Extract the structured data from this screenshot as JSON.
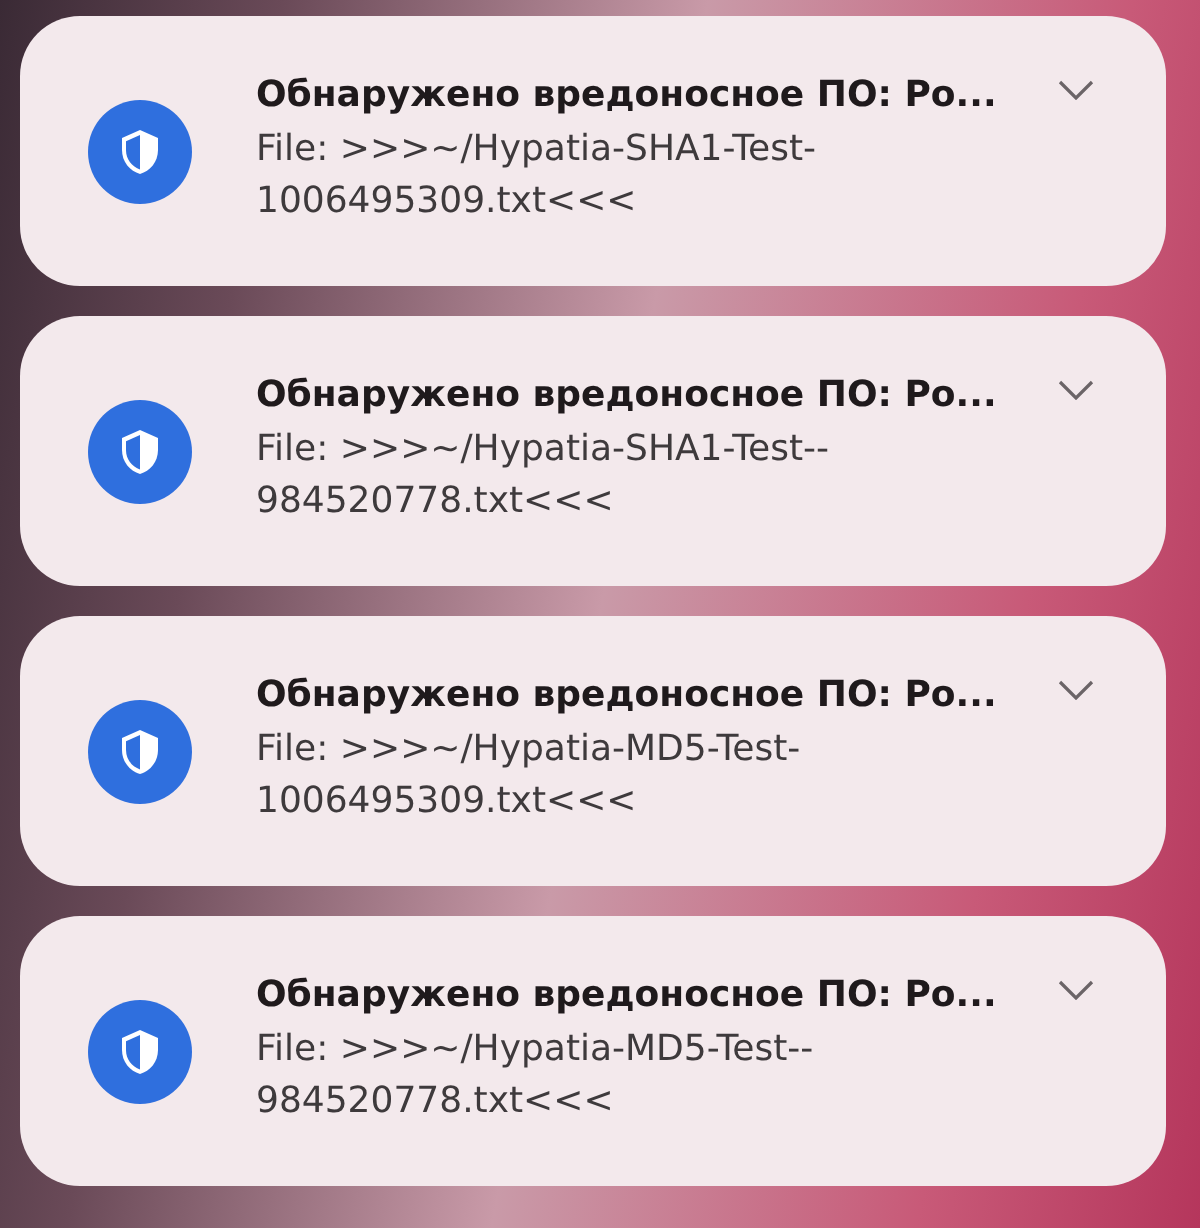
{
  "notifications": [
    {
      "title": "Обнаружено вредоносное ПО: Ро...",
      "body_lines": [
        "File: >>>~/Hypatia-SHA1-Test-",
        "1006495309.txt<<<"
      ]
    },
    {
      "title": "Обнаружено вредоносное ПО: Ро...",
      "body_lines": [
        "File: >>>~/Hypatia-SHA1-Test--",
        "984520778.txt<<<"
      ]
    },
    {
      "title": "Обнаружено вредоносное ПО: Ро...",
      "body_lines": [
        "File: >>>~/Hypatia-MD5-Test-",
        "1006495309.txt<<<"
      ]
    },
    {
      "title": "Обнаружено вредоносное ПО: Ро...",
      "body_lines": [
        "File: >>>~/Hypatia-MD5-Test--",
        "984520778.txt<<<"
      ]
    }
  ]
}
